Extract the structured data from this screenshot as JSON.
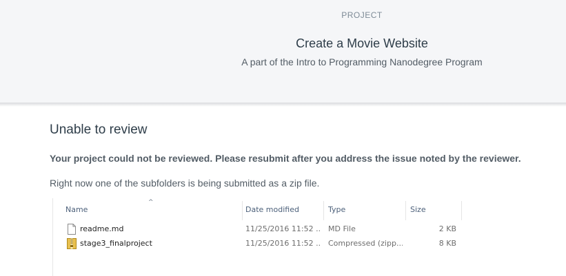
{
  "header": {
    "eyebrow": "PROJECT",
    "title": "Create a Movie Website",
    "subtitle": "A part of the Intro to Programming Nanodegree Program"
  },
  "review": {
    "heading": "Unable to review",
    "notice": "Your project could not be reviewed. Please resubmit after you address the issue noted by the reviewer.",
    "comment": "Right now one of the subfolders is being submitted as a zip file."
  },
  "explorer": {
    "sort_indicator": "^",
    "columns": [
      "Name",
      "Date modified",
      "Type",
      "Size"
    ],
    "files": [
      {
        "icon": "text-file-icon",
        "name": "readme.md",
        "date": "11/25/2016 11:52 ...",
        "type": "MD File",
        "size": "2 KB"
      },
      {
        "icon": "zip-folder-icon",
        "name": "stage3_finalproject",
        "date": "11/25/2016 11:52 ...",
        "type": "Compressed (zipp...",
        "size": "8 KB"
      }
    ]
  },
  "colors": {
    "header_bg": "#f5f6f8",
    "heading_text": "#2e3d49",
    "body_text": "#525c65",
    "explorer_header_text": "#4c607a",
    "zip_icon": "#e8c04f"
  }
}
